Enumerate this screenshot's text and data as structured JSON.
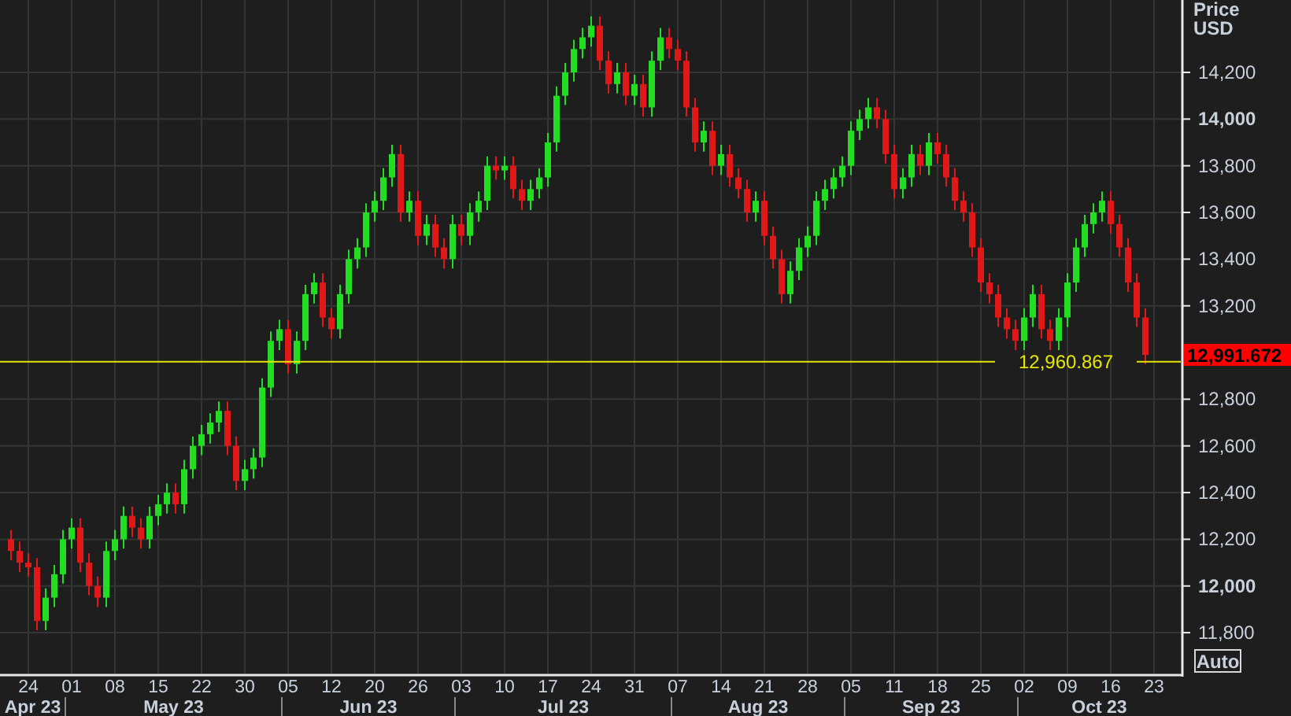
{
  "chart": {
    "axis_title": "Price",
    "axis_unit": "USD",
    "auto_button": "Auto",
    "last_price": "12,991.672",
    "months": [
      "Apr 23",
      "May 23",
      "Jun 23",
      "Jul 23",
      "Aug 23",
      "Sep 23",
      "Oct 23"
    ],
    "chart_data": {
      "type": "candlestick",
      "grid": true,
      "ylim": [
        11625,
        14510
      ],
      "categories": [
        null,
        null,
        "24",
        null,
        null,
        null,
        null,
        "01",
        null,
        null,
        null,
        null,
        "08",
        null,
        null,
        null,
        null,
        "15",
        null,
        null,
        null,
        null,
        "22",
        null,
        null,
        null,
        null,
        "30",
        null,
        null,
        null,
        null,
        "05",
        null,
        null,
        null,
        null,
        "12",
        null,
        null,
        null,
        null,
        "20",
        null,
        null,
        null,
        null,
        "26",
        null,
        null,
        null,
        null,
        "03",
        null,
        null,
        null,
        null,
        "10",
        null,
        null,
        null,
        null,
        "17",
        null,
        null,
        null,
        null,
        "24",
        null,
        null,
        null,
        null,
        "31",
        null,
        null,
        null,
        null,
        "07",
        null,
        null,
        null,
        null,
        "14",
        null,
        null,
        null,
        null,
        "21",
        null,
        null,
        null,
        null,
        "28",
        null,
        null,
        null,
        null,
        "05",
        null,
        null,
        null,
        null,
        "11",
        null,
        null,
        null,
        null,
        "18",
        null,
        null,
        null,
        null,
        "25",
        null,
        null,
        null,
        null,
        "02",
        null,
        null,
        null,
        null,
        "09",
        null,
        null,
        null,
        null,
        "16",
        null,
        null,
        null,
        null,
        "23"
      ],
      "yticks": [
        {
          "value": 11800,
          "label": "11,800"
        },
        {
          "value": 12000,
          "label": "12,000"
        },
        {
          "value": 12200,
          "label": "12,200"
        },
        {
          "value": 12400,
          "label": "12,400"
        },
        {
          "value": 12600,
          "label": "12,600"
        },
        {
          "value": 12800,
          "label": "12,800"
        },
        {
          "value": 13200,
          "label": "13,200"
        },
        {
          "value": 13400,
          "label": "13,400"
        },
        {
          "value": 13600,
          "label": "13,600"
        },
        {
          "value": 13800,
          "label": "13,800"
        },
        {
          "value": 14000,
          "label": "14,000"
        },
        {
          "value": 14200,
          "label": "14,200"
        }
      ],
      "ohlc": [
        [
          12200,
          12240,
          12110,
          12150
        ],
        [
          12150,
          12190,
          12060,
          12100
        ],
        [
          12100,
          12140,
          12040,
          12080
        ],
        [
          12080,
          12120,
          11810,
          11850
        ],
        [
          11850,
          11990,
          11810,
          11950
        ],
        [
          11950,
          12090,
          11910,
          12050
        ],
        [
          12050,
          12240,
          12010,
          12200
        ],
        [
          12200,
          12290,
          12160,
          12250
        ],
        [
          12250,
          12290,
          12060,
          12100
        ],
        [
          12100,
          12140,
          11960,
          12000
        ],
        [
          12000,
          12040,
          11910,
          11950
        ],
        [
          11950,
          12190,
          11910,
          12150
        ],
        [
          12150,
          12240,
          12110,
          12200
        ],
        [
          12200,
          12340,
          12160,
          12300
        ],
        [
          12300,
          12340,
          12210,
          12250
        ],
        [
          12250,
          12290,
          12160,
          12200
        ],
        [
          12200,
          12340,
          12160,
          12300
        ],
        [
          12300,
          12390,
          12260,
          12350
        ],
        [
          12350,
          12440,
          12310,
          12400
        ],
        [
          12400,
          12440,
          12310,
          12350
        ],
        [
          12350,
          12540,
          12310,
          12500
        ],
        [
          12500,
          12640,
          12460,
          12600
        ],
        [
          12600,
          12690,
          12560,
          12650
        ],
        [
          12650,
          12740,
          12610,
          12700
        ],
        [
          12700,
          12790,
          12660,
          12750
        ],
        [
          12750,
          12790,
          12560,
          12600
        ],
        [
          12600,
          12640,
          12410,
          12450
        ],
        [
          12450,
          12540,
          12410,
          12500
        ],
        [
          12500,
          12590,
          12460,
          12550
        ],
        [
          12550,
          12890,
          12510,
          12850
        ],
        [
          12850,
          13090,
          12810,
          13050
        ],
        [
          13050,
          13140,
          13010,
          13100
        ],
        [
          13100,
          13140,
          12910,
          12950
        ],
        [
          12950,
          13090,
          12910,
          13050
        ],
        [
          13050,
          13290,
          13010,
          13250
        ],
        [
          13250,
          13340,
          13210,
          13300
        ],
        [
          13300,
          13340,
          13110,
          13150
        ],
        [
          13150,
          13190,
          13060,
          13100
        ],
        [
          13100,
          13290,
          13060,
          13250
        ],
        [
          13250,
          13440,
          13210,
          13400
        ],
        [
          13400,
          13490,
          13360,
          13450
        ],
        [
          13450,
          13640,
          13410,
          13600
        ],
        [
          13600,
          13690,
          13560,
          13650
        ],
        [
          13650,
          13790,
          13610,
          13750
        ],
        [
          13750,
          13890,
          13710,
          13850
        ],
        [
          13850,
          13890,
          13560,
          13600
        ],
        [
          13600,
          13690,
          13560,
          13650
        ],
        [
          13650,
          13690,
          13460,
          13500
        ],
        [
          13500,
          13590,
          13460,
          13550
        ],
        [
          13550,
          13590,
          13410,
          13450
        ],
        [
          13450,
          13490,
          13360,
          13400
        ],
        [
          13400,
          13590,
          13360,
          13550
        ],
        [
          13550,
          13590,
          13460,
          13500
        ],
        [
          13500,
          13640,
          13460,
          13600
        ],
        [
          13600,
          13690,
          13560,
          13650
        ],
        [
          13650,
          13840,
          13610,
          13800
        ],
        [
          13800,
          13840,
          13740,
          13780
        ],
        [
          13780,
          13840,
          13740,
          13800
        ],
        [
          13800,
          13840,
          13660,
          13700
        ],
        [
          13700,
          13740,
          13610,
          13650
        ],
        [
          13650,
          13740,
          13610,
          13700
        ],
        [
          13700,
          13790,
          13660,
          13750
        ],
        [
          13750,
          13940,
          13710,
          13900
        ],
        [
          13900,
          14140,
          13860,
          14100
        ],
        [
          14100,
          14240,
          14060,
          14200
        ],
        [
          14200,
          14340,
          14160,
          14300
        ],
        [
          14300,
          14390,
          14260,
          14350
        ],
        [
          14350,
          14440,
          14310,
          14400
        ],
        [
          14400,
          14440,
          14210,
          14250
        ],
        [
          14250,
          14290,
          14110,
          14150
        ],
        [
          14150,
          14240,
          14110,
          14200
        ],
        [
          14200,
          14240,
          14060,
          14100
        ],
        [
          14100,
          14190,
          14060,
          14150
        ],
        [
          14150,
          14190,
          14010,
          14050
        ],
        [
          14050,
          14290,
          14010,
          14250
        ],
        [
          14250,
          14390,
          14210,
          14350
        ],
        [
          14350,
          14390,
          14260,
          14300
        ],
        [
          14300,
          14340,
          14210,
          14250
        ],
        [
          14250,
          14290,
          14010,
          14050
        ],
        [
          14050,
          14090,
          13860,
          13900
        ],
        [
          13900,
          13990,
          13860,
          13950
        ],
        [
          13950,
          13990,
          13760,
          13800
        ],
        [
          13800,
          13890,
          13760,
          13850
        ],
        [
          13850,
          13890,
          13710,
          13750
        ],
        [
          13750,
          13790,
          13660,
          13700
        ],
        [
          13700,
          13740,
          13560,
          13600
        ],
        [
          13600,
          13690,
          13560,
          13650
        ],
        [
          13650,
          13690,
          13460,
          13500
        ],
        [
          13500,
          13540,
          13360,
          13400
        ],
        [
          13400,
          13440,
          13210,
          13250
        ],
        [
          13250,
          13390,
          13210,
          13350
        ],
        [
          13350,
          13490,
          13310,
          13450
        ],
        [
          13450,
          13540,
          13410,
          13500
        ],
        [
          13500,
          13690,
          13460,
          13650
        ],
        [
          13650,
          13740,
          13610,
          13700
        ],
        [
          13700,
          13790,
          13660,
          13750
        ],
        [
          13750,
          13840,
          13710,
          13800
        ],
        [
          13800,
          13990,
          13760,
          13950
        ],
        [
          13950,
          14040,
          13910,
          14000
        ],
        [
          14000,
          14090,
          13960,
          14050
        ],
        [
          14050,
          14090,
          13960,
          14000
        ],
        [
          14000,
          14040,
          13810,
          13850
        ],
        [
          13850,
          13890,
          13660,
          13700
        ],
        [
          13700,
          13790,
          13660,
          13750
        ],
        [
          13750,
          13890,
          13710,
          13850
        ],
        [
          13850,
          13890,
          13760,
          13800
        ],
        [
          13800,
          13940,
          13760,
          13900
        ],
        [
          13900,
          13940,
          13810,
          13850
        ],
        [
          13850,
          13890,
          13710,
          13750
        ],
        [
          13750,
          13790,
          13610,
          13650
        ],
        [
          13650,
          13690,
          13560,
          13600
        ],
        [
          13600,
          13640,
          13410,
          13450
        ],
        [
          13450,
          13490,
          13260,
          13300
        ],
        [
          13300,
          13340,
          13210,
          13250
        ],
        [
          13250,
          13290,
          13110,
          13150
        ],
        [
          13150,
          13190,
          13060,
          13100
        ],
        [
          13100,
          13140,
          13010,
          13050
        ],
        [
          13050,
          13190,
          13010,
          13150
        ],
        [
          13150,
          13290,
          13110,
          13250
        ],
        [
          13250,
          13290,
          13060,
          13100
        ],
        [
          13100,
          13140,
          13010,
          13050
        ],
        [
          13050,
          13190,
          13010,
          13150
        ],
        [
          13150,
          13340,
          13110,
          13300
        ],
        [
          13300,
          13490,
          13260,
          13450
        ],
        [
          13450,
          13590,
          13410,
          13550
        ],
        [
          13550,
          13640,
          13510,
          13600
        ],
        [
          13600,
          13690,
          13560,
          13650
        ],
        [
          13650,
          13690,
          13510,
          13550
        ],
        [
          13550,
          13590,
          13410,
          13450
        ],
        [
          13450,
          13490,
          13260,
          13300
        ],
        [
          13300,
          13340,
          13110,
          13150
        ],
        [
          13150,
          13190,
          12950,
          12990
        ],
        null
      ],
      "ref_lines": [
        {
          "axis": "y",
          "value": 12960.867,
          "label": "12,960.867"
        }
      ]
    }
  }
}
